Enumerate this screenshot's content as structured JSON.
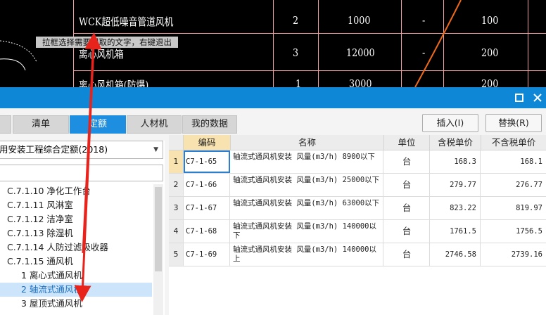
{
  "cad": {
    "rows": [
      {
        "name": "WCK超低噪音管道风机",
        "qty": "2",
        "flow": "1000",
        "dash": "-",
        "val": "100"
      },
      {
        "name": "离心风机箱",
        "qty": "3",
        "flow": "12000",
        "dash": "-",
        "val": "200"
      },
      {
        "name": "离心风机箱(防爆)",
        "qty": "1",
        "flow": "3000",
        "dash": "-",
        "val": "200"
      }
    ],
    "tooltip": "拉框选择需要提取的文字，右键退出"
  },
  "dialog": {
    "tabs": [
      "清单",
      "定额",
      "人材机",
      "我的数据"
    ],
    "active_tab": "定额",
    "insert_label": "插入(I)",
    "replace_label": "替换(R)",
    "maximize_icon": "maximize-icon",
    "close_icon": "close-icon",
    "quota_book": "用安装工程综合定额(2018)",
    "tree": [
      {
        "label": "C.7.1.10 净化工作台"
      },
      {
        "label": "C.7.1.11 风淋室"
      },
      {
        "label": "C.7.1.12 洁净室"
      },
      {
        "label": "C.7.1.13 除湿机"
      },
      {
        "label": "C.7.1.14 人防过滤吸收器"
      },
      {
        "label": "C.7.1.15 通风机"
      },
      {
        "label": "1 离心式通风机"
      },
      {
        "label": "2 轴流式通风机"
      },
      {
        "label": "3 屋顶式通风机"
      }
    ],
    "selected_tree_item": "2 轴流式通风机",
    "grid": {
      "headers": [
        "",
        "编码",
        "名称",
        "单位",
        "含税单价",
        "不含税单价"
      ],
      "rows": [
        {
          "num": "1",
          "code": "C7-1-65",
          "name": "轴流式通风机安装 风量(m3/h) 8900以下",
          "unit": "台",
          "tax_price": "168.3",
          "notax_price": "168.1"
        },
        {
          "num": "2",
          "code": "C7-1-66",
          "name": "轴流式通风机安装 风量(m3/h) 25000以下",
          "unit": "台",
          "tax_price": "279.77",
          "notax_price": "276.77"
        },
        {
          "num": "3",
          "code": "C7-1-67",
          "name": "轴流式通风机安装 风量(m3/h) 63000以下",
          "unit": "台",
          "tax_price": "823.22",
          "notax_price": "819.97"
        },
        {
          "num": "4",
          "code": "C7-1-68",
          "name": "轴流式通风机安装 风量(m3/h) 140000以下",
          "unit": "台",
          "tax_price": "1761.5",
          "notax_price": "1756.5"
        },
        {
          "num": "5",
          "code": "C7-1-69",
          "name": "轴流式通风机安装 风量(m3/h) 140000以上",
          "unit": "台",
          "tax_price": "2746.58",
          "notax_price": "2739.16"
        }
      ]
    }
  },
  "colors": {
    "accent": "#0e87d6",
    "arrow": "#e8231c",
    "cad_line": "#f0a0a0",
    "cad_curve": "#f06a1a"
  }
}
